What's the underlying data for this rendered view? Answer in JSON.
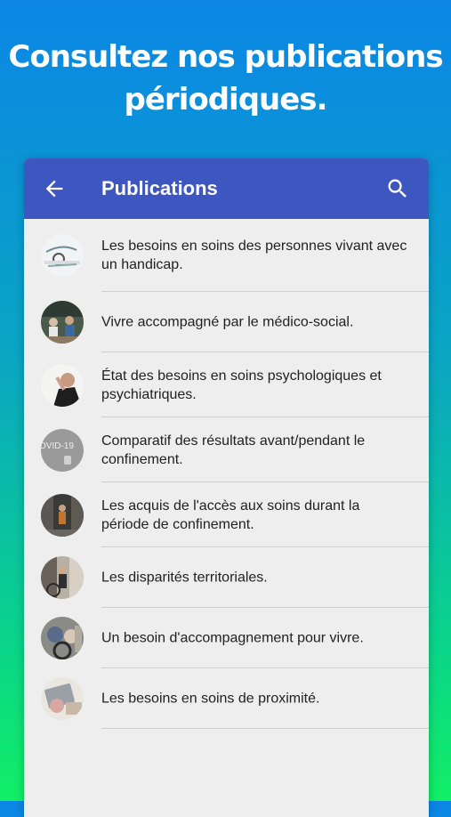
{
  "promo": {
    "line1": "Consultez nos publications",
    "line2": "périodiques."
  },
  "appbar": {
    "title": "Publications",
    "back_icon": "arrow-left-icon",
    "search_icon": "search-icon",
    "color": "#3e56c0"
  },
  "publications": [
    {
      "label": "Les besoins en soins des personnes vivant avec un handicap."
    },
    {
      "label": "Vivre accompagné par le médico-social."
    },
    {
      "label": "État des besoins en soins psychologiques et psychiatriques."
    },
    {
      "label": "Comparatif des résultats avant/pendant le confinement."
    },
    {
      "label": "Les acquis de l'accès aux soins durant la période de confinement."
    },
    {
      "label": "Les disparités territoriales."
    },
    {
      "label": "Un besoin d'accompagnement pour vivre."
    },
    {
      "label": "Les besoins en soins de proximité."
    }
  ],
  "thumb_text": "OVID-19"
}
